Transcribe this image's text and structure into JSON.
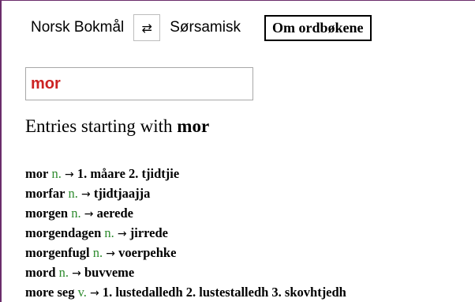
{
  "topbar": {
    "source_lang": "Norsk Bokmål",
    "swap_symbol": "⇄",
    "target_lang": "Sørsamisk",
    "about_label": "Om ordbøkene"
  },
  "search": {
    "value": "mor",
    "placeholder": ""
  },
  "results": {
    "heading_prefix": "Entries starting with",
    "heading_term": "mor",
    "arrow": "→",
    "entries": [
      {
        "headword": "mor",
        "pos": "n.",
        "translation": "1. måare 2. tjidtjie"
      },
      {
        "headword": "morfar",
        "pos": "n.",
        "translation": "tjidtjaajja"
      },
      {
        "headword": "morgen",
        "pos": "n.",
        "translation": "aerede"
      },
      {
        "headword": "morgendagen",
        "pos": "n.",
        "translation": "jirrede"
      },
      {
        "headword": "morgenfugl",
        "pos": "n.",
        "translation": "voerpehke"
      },
      {
        "headword": "mord",
        "pos": "n.",
        "translation": "buvveme"
      },
      {
        "headword": "more seg",
        "pos": "v.",
        "translation": "1. lustedalledh 2. lustestalledh 3. skovhtjedh"
      }
    ]
  }
}
